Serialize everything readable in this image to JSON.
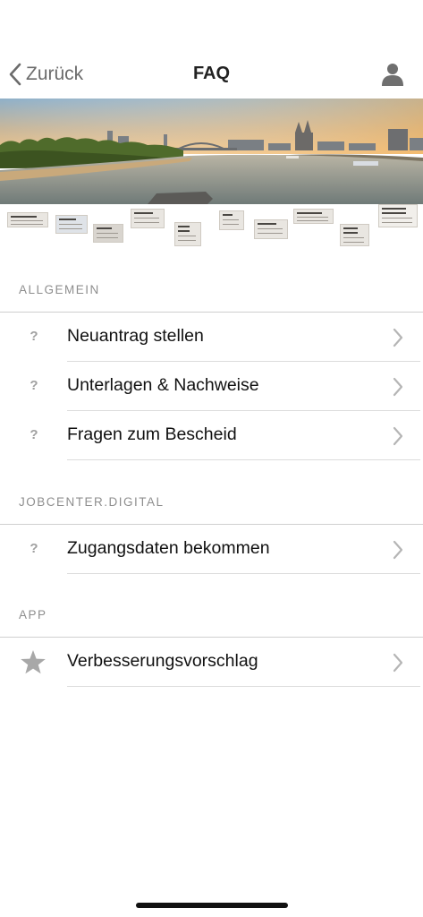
{
  "nav": {
    "back_label": "Zurück",
    "title": "FAQ",
    "profile_icon": "person-icon"
  },
  "banner": {
    "location_cards": [
      {
        "title": "Köln-Porz",
        "lines": [
          "Friedrichstraße 39 - 41",
          "51143 Köln"
        ]
      },
      {
        "title": "Köln-Mülheim",
        "lines": [
          "Wiener Platz",
          "51065 Köln"
        ]
      },
      {
        "title": "Kalk",
        "lines": [
          "Ottmar-Pohl-Platz 5",
          "51103 Köln"
        ]
      },
      {
        "title": "Köln-Kalk",
        "lines": [
          "Ottmar-Pohl-Platz",
          "51103 Köln"
        ]
      },
      {
        "title": "Köln-Nord - Nippes",
        "lines": [
          "Neusser Str. 450",
          "50733 Köln"
        ]
      },
      {
        "title": "Ehrenfeld",
        "lines": [
          "Rheingold Str.",
          "50823 Köln"
        ]
      },
      {
        "title": "Köln-Mitte",
        "lines": [
          "Luxemburger Str. 40",
          "50674 Köln"
        ]
      },
      {
        "title": "Köln-Süd",
        "lines": [
          "Bonner Str.",
          "50677 Köln"
        ]
      },
      {
        "title": "Köln-Nord - Chorweiler",
        "lines": [
          "Pariser Platz",
          "50765 Köln"
        ]
      },
      {
        "title": "U25 Jobcenter Team und Projekte",
        "lines": [
          "Luxemburger Str.",
          "50939 Köln"
        ]
      }
    ]
  },
  "sections": [
    {
      "header": "ALLGEMEIN",
      "items": [
        {
          "label": "Neuantrag stellen",
          "icon": "question-icon"
        },
        {
          "label": "Unterlagen & Nachweise",
          "icon": "question-icon"
        },
        {
          "label": "Fragen zum Bescheid",
          "icon": "question-icon"
        }
      ]
    },
    {
      "header": "JOBCENTER.DIGITAL",
      "items": [
        {
          "label": "Zugangsdaten bekommen",
          "icon": "question-icon"
        }
      ]
    },
    {
      "header": "APP",
      "items": [
        {
          "label": "Verbesserungsvorschlag",
          "icon": "star-icon"
        }
      ]
    }
  ],
  "question_glyph": "?",
  "colors": {
    "accent_gray": "#8e8e8e",
    "chevron": "#b5b5b5",
    "separator": "#dcdcdc"
  }
}
